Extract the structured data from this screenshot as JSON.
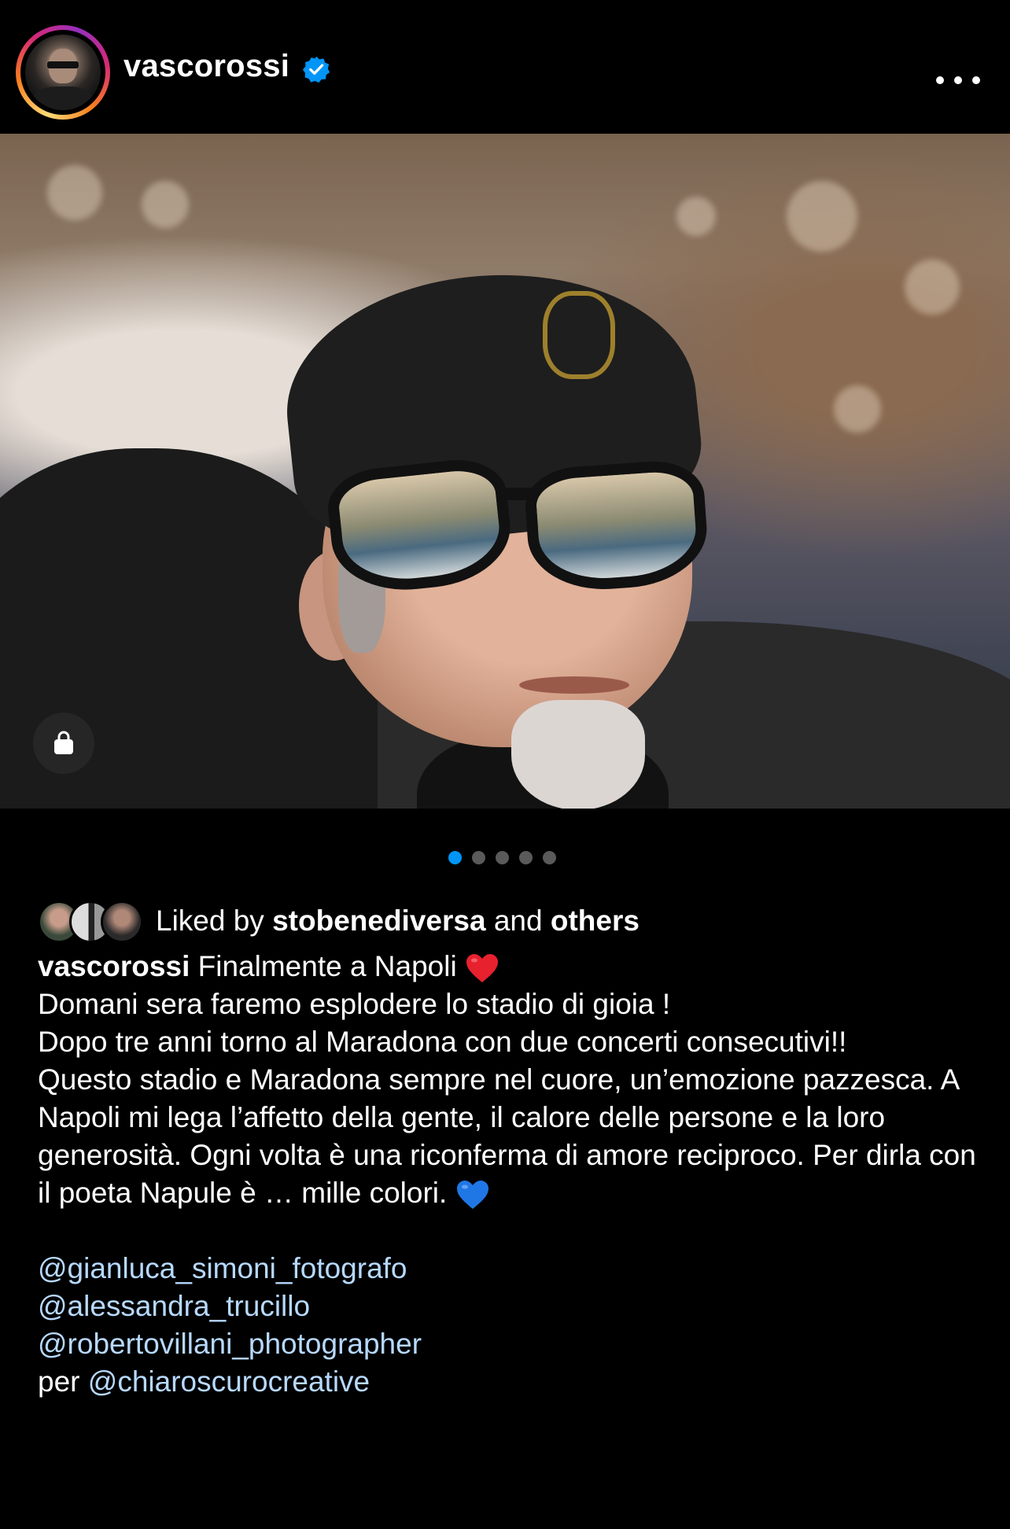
{
  "header": {
    "username": "vascorossi",
    "verified_icon": "verified-badge-icon",
    "more_icon": "more-options-icon"
  },
  "post": {
    "carousel": {
      "count": 5,
      "active_index": 0
    },
    "shop_icon": "shopping-bag-icon"
  },
  "likes": {
    "prefix": "Liked by",
    "user": "stobenediversa",
    "connector": "and",
    "others": "others"
  },
  "caption": {
    "author": "vascorossi",
    "line1": "Finalmente a Napoli",
    "line1_emoji": "red-heart-icon",
    "line2": "Domani sera faremo esplodere lo stadio di gioia !",
    "line3": "Dopo tre anni torno al Maradona con due concerti consecutivi!!",
    "line4": "Questo stadio e Maradona sempre nel cuore, un’emozione pazzesca. A Napoli mi lega l’affetto della gente, il calore delle persone e la loro generosità. Ogni volta è una riconferma di amore reciproco. Per dirla con il poeta Napule è … mille colori.",
    "line4_emoji": "blue-heart-icon",
    "mentions": [
      "@gianluca_simoni_fotografo",
      "@alessandra_trucillo",
      "@robertovillani_photographer"
    ],
    "credit_prefix": "per",
    "credit_mention": "@chiaroscurocreative"
  },
  "colors": {
    "background": "#000000",
    "text": "#ffffff",
    "mention": "#b7d9ff",
    "carousel_active": "#0095f6",
    "verified": "#0095f6"
  }
}
